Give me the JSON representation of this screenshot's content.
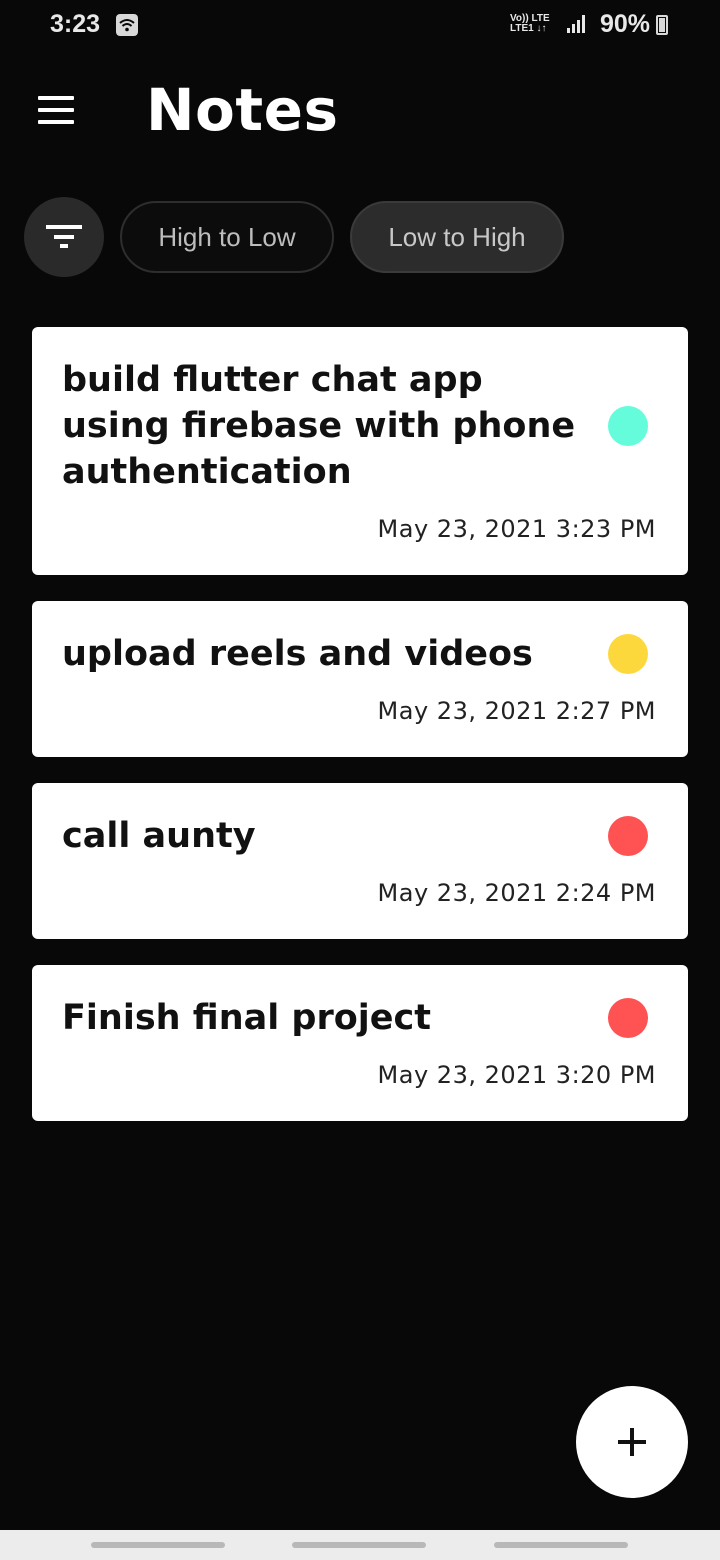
{
  "status_bar": {
    "time": "3:23",
    "network_top": "Vo)) LTE",
    "network_bottom": "LTE1 ↓↑",
    "battery": "90%"
  },
  "header": {
    "title": "Notes",
    "menu_icon": "hamburger-menu-icon"
  },
  "filters": {
    "filter_icon": "filter-list-icon",
    "high_to_low": "High to Low",
    "low_to_high": "Low to High",
    "selected": "Low to High"
  },
  "notes": [
    {
      "title": "build flutter chat app using firebase with phone authentication",
      "date": "May 23, 2021 3:23 PM",
      "color": "#64FCDA"
    },
    {
      "title": "upload reels and videos",
      "date": "May 23, 2021 2:27 PM",
      "color": "#FDD83D"
    },
    {
      "title": "call aunty",
      "date": "May 23, 2021 2:24 PM",
      "color": "#FF5252"
    },
    {
      "title": "Finish final project",
      "date": "May 23, 2021 3:20 PM",
      "color": "#FF5252"
    }
  ],
  "fab": {
    "icon": "plus-icon"
  },
  "colors": {
    "background": "#080808",
    "card": "#FFFFFF",
    "chip_selected": "#2C2C2C"
  }
}
